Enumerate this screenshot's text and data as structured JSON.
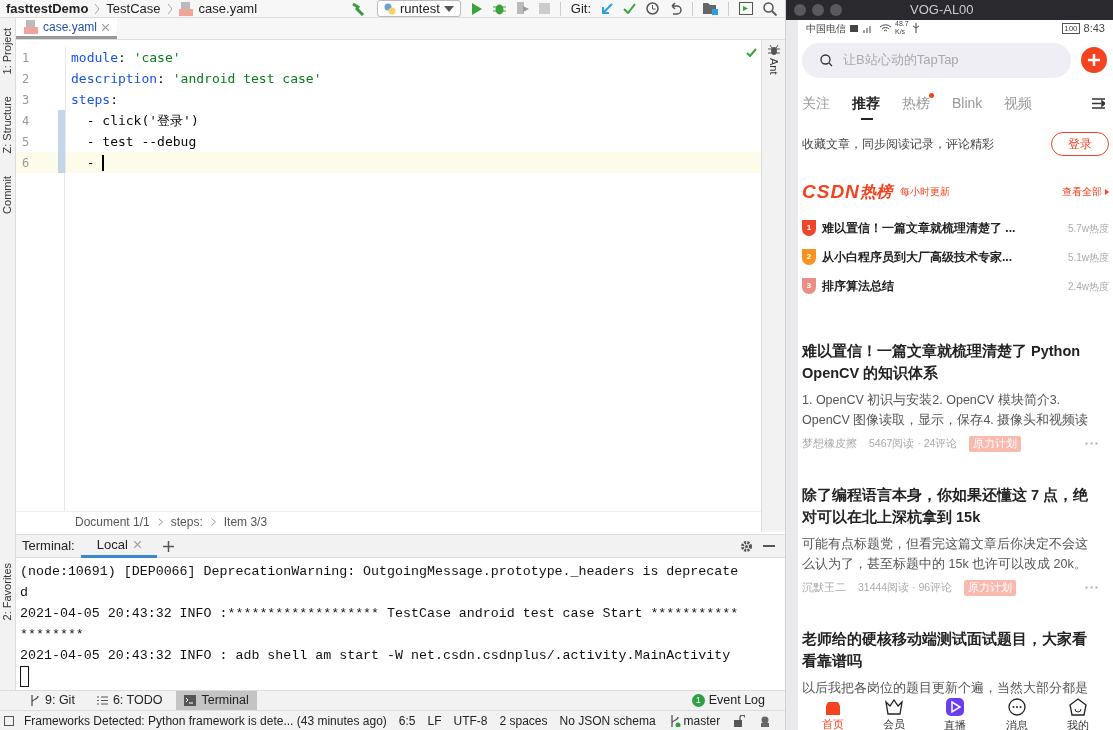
{
  "ide": {
    "breadcrumb": [
      "fasttestDemo",
      "TestCase",
      "case.yaml"
    ],
    "run_config": "runtest",
    "git_label": "Git:",
    "left_tool_tabs": [
      "1: Project",
      "Z: Structure",
      "Commit"
    ],
    "favorites_tab": "2: Favorites",
    "right_tool_tabs": [
      "Ant"
    ],
    "editor_tabs": [
      {
        "label": "case.yaml",
        "selected": true
      }
    ],
    "code_lines": [
      {
        "number": "1",
        "changed": false,
        "current": false,
        "tokens": [
          {
            "kind": "key",
            "text": "module"
          },
          {
            "kind": "plain",
            "text": ": "
          },
          {
            "kind": "string",
            "text": "'case'"
          }
        ]
      },
      {
        "number": "2",
        "changed": false,
        "current": false,
        "tokens": [
          {
            "kind": "key",
            "text": "description"
          },
          {
            "kind": "plain",
            "text": ": "
          },
          {
            "kind": "string",
            "text": "'android test case'"
          }
        ]
      },
      {
        "number": "3",
        "changed": false,
        "current": false,
        "tokens": [
          {
            "kind": "key",
            "text": "steps"
          },
          {
            "kind": "plain",
            "text": ":"
          }
        ]
      },
      {
        "number": "4",
        "changed": true,
        "current": false,
        "tokens": [
          {
            "kind": "plain",
            "text": "  - click('登录')"
          }
        ]
      },
      {
        "number": "5",
        "changed": true,
        "current": false,
        "tokens": [
          {
            "kind": "plain",
            "text": "  - test --debug"
          }
        ]
      },
      {
        "number": "6",
        "changed": true,
        "current": true,
        "tokens": [
          {
            "kind": "plain",
            "text": "  - "
          }
        ]
      }
    ],
    "editor_breadcrumb": [
      "Document 1/1",
      "steps:",
      "Item 3/3"
    ],
    "terminal": {
      "title": "Terminal:",
      "tabs": [
        {
          "label": "Local",
          "selected": true
        }
      ],
      "lines": [
        "(node:10691) [DEP0066] DeprecationWarning: OutgoingMessage.prototype._headers is deprecate",
        "d",
        "2021-04-05 20:43:32 INFO :******************* TestCase android test case Start ***********",
        "********",
        "2021-04-05 20:43:32 INFO : adb shell am start -W net.csdn.csdnplus/.activity.MainActivity"
      ]
    },
    "tool_tabs": [
      {
        "label": "9: Git",
        "kind": "git",
        "selected": false
      },
      {
        "label": "6: TODO",
        "kind": "todo",
        "selected": false
      },
      {
        "label": "Terminal",
        "kind": "terminal",
        "selected": true
      }
    ],
    "event_log": {
      "count": "1",
      "label": "Event Log"
    },
    "status_bar": {
      "message": "Frameworks Detected: Python framework is dete... (43 minutes ago)",
      "items": [
        "6:5",
        "LF",
        "UTF-8",
        "2 spaces",
        "No JSON schema"
      ],
      "branch": "master"
    }
  },
  "phone": {
    "window_title": "VOG-AL00",
    "status_bar": {
      "carrier": "中国电信",
      "speed": "48.7",
      "speed_unit": "K/s",
      "battery": "100",
      "time": "8:43"
    },
    "search": {
      "placeholder": "让B站心动的TapTap"
    },
    "tabs": [
      {
        "label": "关注",
        "selected": false,
        "dot": false
      },
      {
        "label": "推荐",
        "selected": true,
        "dot": false
      },
      {
        "label": "热榜",
        "selected": false,
        "dot": true
      },
      {
        "label": "Blink",
        "selected": false,
        "dot": false
      },
      {
        "label": "视频",
        "selected": false,
        "dot": false
      }
    ],
    "login_prompt": {
      "text": "收藏文章，同步阅读记录，评论精彩",
      "button": "登录"
    },
    "hot": {
      "logo_latin": "CSDN",
      "logo_cjk": "热榜",
      "subtitle": "每小时更新",
      "more": "查看全部",
      "items": [
        {
          "rank": "1",
          "title": "难以置信！一篇文章就梳理清楚了 ...",
          "heat": "5.7w热度",
          "color": "#f0452a"
        },
        {
          "rank": "2",
          "title": "从小白程序员到大厂高级技术专家...",
          "heat": "5.1w热度",
          "color": "#f7931e"
        },
        {
          "rank": "3",
          "title": "排序算法总结",
          "heat": "2.4w热度",
          "color": "#eb8f86"
        }
      ]
    },
    "articles": [
      {
        "title": "难以置信！一篇文章就梳理清楚了 Python OpenCV 的知识体系",
        "summary": "1. OpenCV 初识与安装2. OpenCV 模块简介3. OpenCV 图像读取，显示，保存4. 摄像头和视频读",
        "author": "梦想橡皮擦",
        "stats": "5467阅读 · 24评论",
        "tag": "原力计划"
      },
      {
        "title": "除了编程语言本身，你如果还懂这 7 点，绝对可以在北上深杭拿到 15k",
        "summary": "可能有点标题党，但看完这篇文章后你决定不会这么认为了，甚至标题中的 15k 也许可以改成 20k。",
        "author": "沉默王二",
        "stats": "31444阅读 · 96评论",
        "tag": "原力计划"
      },
      {
        "title": "老师给的硬核移动端测试面试题目，大家看看靠谱吗",
        "summary": "以后我把各岗位的题目更新个遍，当然大部分都是"
      }
    ],
    "bottom_nav": [
      {
        "label": "首页",
        "kind": "home",
        "selected": true
      },
      {
        "label": "会员",
        "kind": "vip",
        "selected": false
      },
      {
        "label": "直播",
        "kind": "live",
        "selected": false
      },
      {
        "label": "消息",
        "kind": "message",
        "selected": false
      },
      {
        "label": "我的",
        "kind": "profile",
        "selected": false
      }
    ]
  }
}
